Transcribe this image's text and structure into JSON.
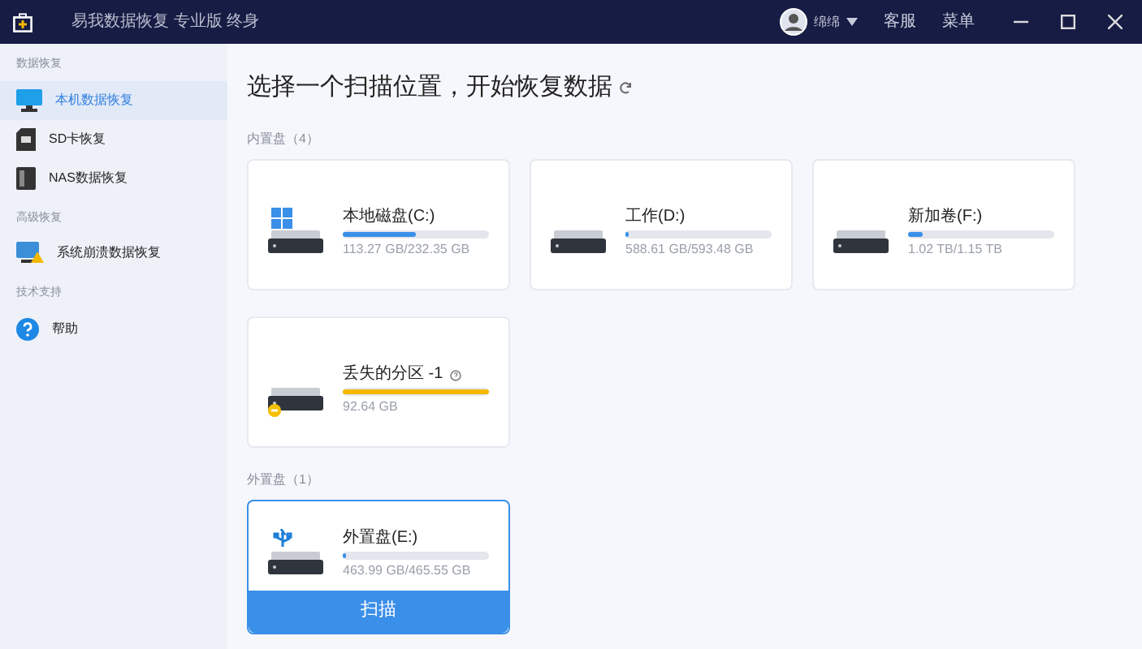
{
  "window": {
    "title": "易我数据恢复 专业版 终身",
    "user": "绵绵",
    "menu_items": [
      "客服",
      "菜单"
    ]
  },
  "sidebar": [
    {
      "heading": "数据恢复",
      "items": [
        {
          "label": "本机数据恢复",
          "kind": "monitor",
          "selected": true
        },
        {
          "label": "SD卡恢复",
          "kind": "sd",
          "selected": false
        },
        {
          "label": "NAS数据恢复",
          "kind": "nas",
          "selected": false
        }
      ]
    },
    {
      "heading": "高级恢复",
      "items": [
        {
          "label": "系统崩溃数据恢复",
          "kind": "crash",
          "selected": false
        }
      ]
    },
    {
      "heading": "技术支持",
      "items": [
        {
          "label": "帮助",
          "kind": "help",
          "selected": false
        }
      ]
    }
  ],
  "main": {
    "title": "选择一个扫描位置，开始恢复数据",
    "sections": [
      {
        "heading": "内置盘（4）",
        "drives": [
          {
            "name": "本地磁盘(C:)",
            "size": "113.27 GB/232.35 GB",
            "level": 0.5,
            "kind": "windows",
            "selected": false
          },
          {
            "name": "工作(D:)",
            "size": "588.61 GB/593.48 GB",
            "level": 0.02,
            "kind": "plain",
            "selected": false
          },
          {
            "name": "新加卷(F:)",
            "size": "1.02 TB/1.15 TB",
            "level": 0.1,
            "kind": "plain",
            "selected": false
          },
          {
            "name": "丢失的分区 -1",
            "size": "92.64 GB",
            "level": 1,
            "kind": "lost",
            "selected": false
          }
        ]
      },
      {
        "heading": "外置盘（1）",
        "drives": [
          {
            "name": "外置盘(E:)",
            "size": "463.99 GB/465.55 GB",
            "level": 0.02,
            "kind": "usb",
            "selected": true
          }
        ]
      }
    ],
    "scan_button": "扫描"
  }
}
